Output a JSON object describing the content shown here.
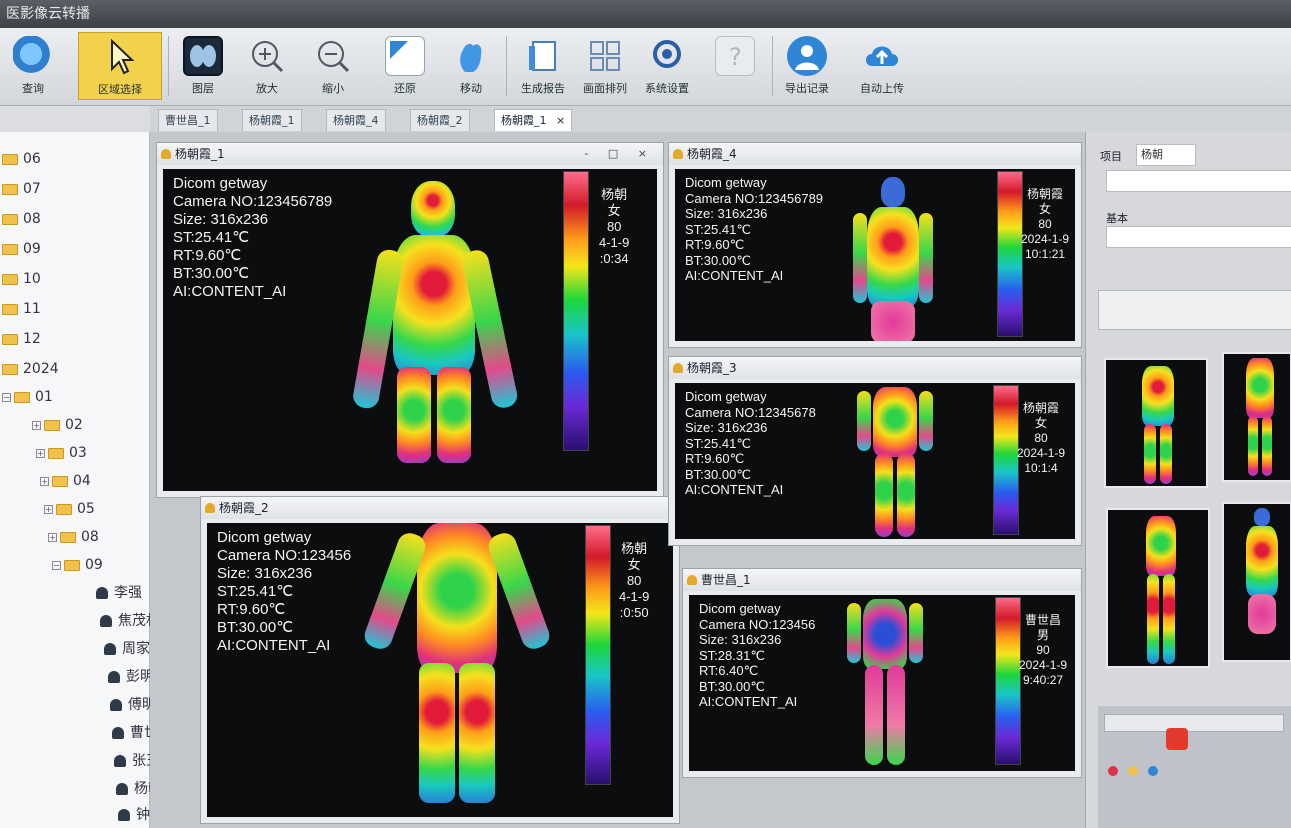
{
  "window": {
    "title": "医影像云转播"
  },
  "toolbar": {
    "buttons": [
      {
        "label": "查询"
      },
      {
        "label": "区域选择"
      },
      {
        "label": "图层"
      },
      {
        "label": "放大"
      },
      {
        "label": "缩小"
      },
      {
        "label": "还原"
      },
      {
        "label": "移动"
      },
      {
        "label": "生成报告"
      },
      {
        "label": "画面排列"
      },
      {
        "label": "系统设置"
      },
      {
        "label": ""
      },
      {
        "label": "导出记录"
      },
      {
        "label": "自动上传"
      }
    ]
  },
  "tabs": [
    {
      "label": "曹世昌_1"
    },
    {
      "label": "杨朝霞_1"
    },
    {
      "label": "杨朝霞_4"
    },
    {
      "label": "杨朝霞_2"
    },
    {
      "label": "杨朝霞_1",
      "close": "×"
    }
  ],
  "tree": {
    "items": [
      {
        "label": "06"
      },
      {
        "label": "07"
      },
      {
        "label": "08"
      },
      {
        "label": "09"
      },
      {
        "label": "10"
      },
      {
        "label": "11"
      },
      {
        "label": "12"
      },
      {
        "label": "2024"
      },
      {
        "label": "01"
      },
      {
        "label": "02"
      },
      {
        "label": "03"
      },
      {
        "label": "04"
      },
      {
        "label": "05"
      },
      {
        "label": "08"
      },
      {
        "label": "09"
      }
    ],
    "patients": [
      {
        "label": "李强"
      },
      {
        "label": "焦茂林"
      },
      {
        "label": "周家平"
      },
      {
        "label": "彭明娟"
      },
      {
        "label": "傅明莲"
      },
      {
        "label": "曹世昌"
      },
      {
        "label": "张玉昭"
      },
      {
        "label": "杨朝霞"
      },
      {
        "label": "钟国英"
      }
    ]
  },
  "panels": [
    {
      "title": "杨朝霞_1",
      "controls": "- □ ×",
      "info": [
        "Dicom getway",
        "Camera NO:123456789",
        "Size: 316x236",
        "ST:25.41℃",
        "RT:9.60℃",
        "BT:30.00℃",
        "AI:CONTENT_AI"
      ],
      "side": [
        "杨朝",
        "女",
        "80",
        "4-1-9",
        ":0:34"
      ]
    },
    {
      "title": "杨朝霞_4",
      "info": [
        "Dicom getway",
        "Camera NO:123456789",
        "Size: 316x236",
        "ST:25.41℃",
        "RT:9.60℃",
        "BT:30.00℃",
        "AI:CONTENT_AI"
      ],
      "side": [
        "杨朝霞",
        "女",
        "80",
        "2024-1-9",
        "10:1:21"
      ]
    },
    {
      "title": "杨朝霞_2",
      "info": [
        "Dicom getway",
        "Camera NO:123456",
        "Size: 316x236",
        "ST:25.41℃",
        "RT:9.60℃",
        "BT:30.00℃",
        "AI:CONTENT_AI"
      ],
      "side": [
        "杨朝",
        "女",
        "80",
        "4-1-9",
        ":0:50"
      ]
    },
    {
      "title": "杨朝霞_3",
      "info": [
        "Dicom getway",
        "Camera NO:12345678",
        "Size: 316x236",
        "ST:25.41℃",
        "RT:9.60℃",
        "BT:30.00℃",
        "AI:CONTENT_AI"
      ],
      "side": [
        "杨朝霞",
        "女",
        "80",
        "2024-1-9",
        "10:1:4"
      ]
    },
    {
      "title": "曹世昌_1",
      "info": [
        "Dicom getway",
        "Camera NO:123456",
        "Size: 316x236",
        "ST:28.31℃",
        "RT:6.40℃",
        "BT:30.00℃",
        "AI:CONTENT_AI"
      ],
      "side": [
        "曹世昌",
        "男",
        "90",
        "2024-1-9",
        "9:40:27"
      ]
    }
  ],
  "right": {
    "label_top": "项目",
    "field_top": "杨朝",
    "label_mid": "基本"
  }
}
